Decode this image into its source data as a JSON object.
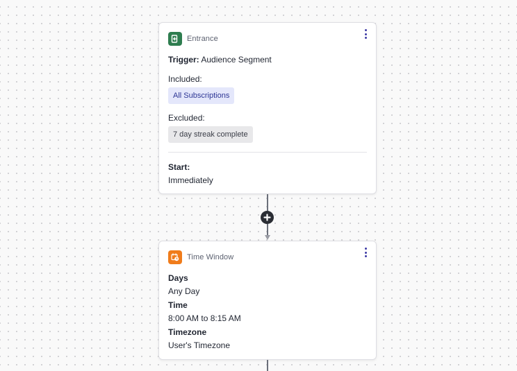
{
  "colors": {
    "entrance_icon": "#2e7d4f",
    "time_window_icon": "#f07c1b",
    "menu_dots": "#3e3ba6",
    "included_pill_bg": "#e4e7fb",
    "excluded_pill_bg": "#e8e8ea"
  },
  "entrance": {
    "icon": "entrance-door-icon",
    "type_label": "Entrance",
    "trigger_label": "Trigger:",
    "trigger_value": "Audience Segment",
    "included_label": "Included:",
    "included_pill": "All Subscriptions",
    "excluded_label": "Excluded:",
    "excluded_pill": "7 day streak complete",
    "start_label": "Start:",
    "start_value": "Immediately"
  },
  "connector": {
    "add_icon": "plus-icon"
  },
  "time_window": {
    "icon": "calendar-clock-icon",
    "type_label": "Time Window",
    "days_label": "Days",
    "days_value": "Any Day",
    "time_label": "Time",
    "time_value": "8:00 AM to 8:15 AM",
    "timezone_label": "Timezone",
    "timezone_value": "User's Timezone"
  }
}
